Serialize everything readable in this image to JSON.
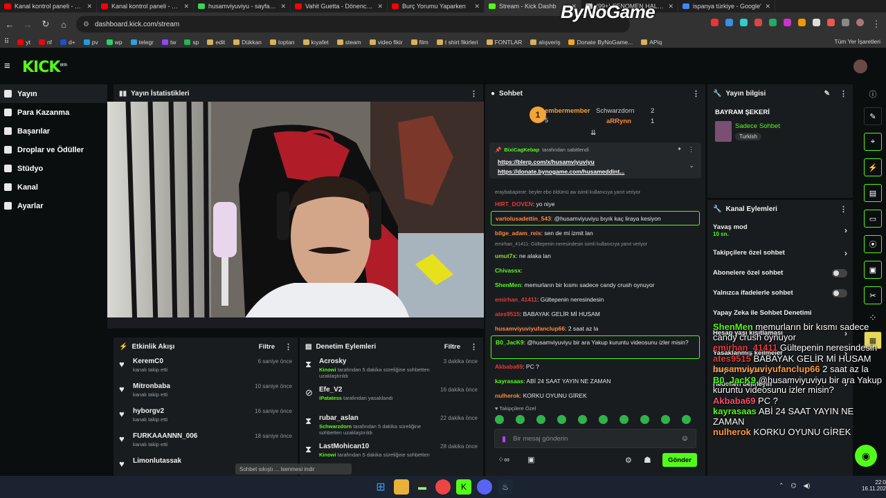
{
  "browser": {
    "tabs": [
      {
        "title": "Kanal kontrol paneli - You",
        "color": "#ff0000"
      },
      {
        "title": "Kanal kontrol paneli - You",
        "color": "#ff0000"
      },
      {
        "title": "husamviyuviyu - sayfa 2 -",
        "color": "#3ad35a"
      },
      {
        "title": "Vahit Guetta - Dönence M",
        "color": "#ff0000"
      },
      {
        "title": "Burç Yorumu Yaparken",
        "color": "#ff0000"
      },
      {
        "title": "Stream - Kick Dashb",
        "color": "#53fc18"
      },
      {
        "title": "(99+) FENOMEN HALO D",
        "color": "#cccccc"
      },
      {
        "title": "ispanya türkiye - Google'",
        "color": "#4285f4"
      }
    ],
    "url": "dashboard.kick.com/stream",
    "watermark": "ByNoGame",
    "bookmarks": [
      {
        "label": "yt",
        "color": "#ff0000"
      },
      {
        "label": "nf",
        "color": "#e50914"
      },
      {
        "label": "d+",
        "color": "#1f4fd1"
      },
      {
        "label": "pv",
        "color": "#1aa0e6"
      },
      {
        "label": "wp",
        "color": "#25d366"
      },
      {
        "label": "telegr",
        "color": "#2aa1da"
      },
      {
        "label": "tw",
        "color": "#9146ff"
      },
      {
        "label": "sp",
        "color": "#1db954"
      },
      {
        "label": "edit",
        "color": "#d8b15a"
      },
      {
        "label": "Dükkan",
        "color": "#d8b15a"
      },
      {
        "label": "toptan",
        "color": "#d8b15a"
      },
      {
        "label": "kıyafet",
        "color": "#d8b15a"
      },
      {
        "label": "steam",
        "color": "#d8b15a"
      },
      {
        "label": "video fikir",
        "color": "#d8b15a"
      },
      {
        "label": "film",
        "color": "#d8b15a"
      },
      {
        "label": "t shirt fikirleri",
        "color": "#d8b15a"
      },
      {
        "label": "FONTLAR",
        "color": "#d8b15a"
      },
      {
        "label": "alışveriş",
        "color": "#d8b15a"
      },
      {
        "label": "Donate ByNoGame...",
        "color": "#f5a623"
      },
      {
        "label": "APiq",
        "color": "#d8b15a"
      }
    ],
    "all_bookmarks": "Tüm Yer İşaretleri"
  },
  "kick": {
    "logo": "KICK",
    "logo_badge": "BETA",
    "sidebar": [
      {
        "label": "Yayın",
        "active": true
      },
      {
        "label": "Para Kazanma",
        "active": false
      },
      {
        "label": "Başarılar",
        "active": false
      },
      {
        "label": "Droplar ve Ödüller",
        "active": false
      },
      {
        "label": "Stüdyo",
        "active": false
      },
      {
        "label": "Kanal",
        "active": false
      },
      {
        "label": "Ayarlar",
        "active": false
      }
    ]
  },
  "stats_panel": {
    "title": "Yayın İstatistikleri"
  },
  "activity_panel": {
    "title": "Etkinlik Akışı",
    "filter": "Filtre",
    "items": [
      {
        "name": "KeremC0",
        "sub": "kanalı takip etti",
        "time": "6 saniye önce"
      },
      {
        "name": "Mitronbaba",
        "sub": "kanalı takip etti",
        "time": "10 saniye önce"
      },
      {
        "name": "hyborgv2",
        "sub": "kanalı takip etti",
        "time": "16 saniye önce"
      },
      {
        "name": "FURKAAANNN_006",
        "sub": "kanalı takip etti",
        "time": "18 saniye önce"
      },
      {
        "name": "Limonlutassak",
        "sub": "",
        "time": ""
      }
    ]
  },
  "moderation_panel": {
    "title": "Denetim Eylemleri",
    "filter": "Filtre",
    "items": [
      {
        "name": "Acrosky",
        "actor": "Kinowi",
        "sub": "tarafından 5 dakika süreliğine sohbetten uzaklaştırıldı",
        "time": "3 dakika önce",
        "icon": "⧗"
      },
      {
        "name": "Efe_V2",
        "actor": "iPatatess",
        "sub": "tarafından yasaklandı",
        "time": "16 dakika önce",
        "icon": "⊘"
      },
      {
        "name": "rubar_aslan",
        "actor": "Schwarzdorn",
        "sub": "tarafından 5 dakika süreliğine sohbetten uzaklaştırıldı",
        "time": "22 dakika önce",
        "icon": "⧗"
      },
      {
        "name": "LastMohican10",
        "actor": "Kinowi",
        "sub": "tarafından 5 dakika süreliğine sohbetten",
        "time": "28 dakika önce",
        "icon": "⧗"
      }
    ],
    "toast": "Sohbet sıkıştı ... lsenmesi indir"
  },
  "chat": {
    "title": "Sohbet",
    "leaderboard": {
      "first": {
        "name": "embermember",
        "count": "5"
      },
      "second": {
        "name": "Schwarzdorn",
        "count": "2"
      },
      "third": {
        "name": "aRRynn",
        "count": "1"
      }
    },
    "pinned": {
      "by": "BixiCagKebap",
      "by_suffix": "tarafından sabitlendi",
      "line1": "https://blerp.com/x/husamviyuviyu",
      "line2": "https://donate.bynogame.com/husameddint..."
    },
    "messages": [
      {
        "type": "reply",
        "text": "eraybabapirotr: beyler ebo öldümü aw isimli kullanıcıya yanıt veriyor"
      },
      {
        "type": "msg",
        "user": "HIRT_DOVEN",
        "color": "#e33b3b",
        "text": "yo niye"
      },
      {
        "type": "hl",
        "user": "vartolusadettin_543",
        "color": "#ff8a3c",
        "text": "@husamviyuviyu bıyık kaç liraya kesiyon"
      },
      {
        "type": "msg",
        "user": "bilge_adam_reis",
        "color": "#ff8a3c",
        "text": "sen de mi izmit lan"
      },
      {
        "type": "reply",
        "text": "emirhan_41411: Gültepenin neresindesin isimli kullanıcıya yanıt veriyor"
      },
      {
        "type": "msg",
        "user": "umut7x",
        "color": "#8bdc3c",
        "text": "ne alaka lan"
      },
      {
        "type": "msg",
        "user": "Chivassx",
        "color": "#53fc18",
        "text": ""
      },
      {
        "type": "msg",
        "user": "ShenMen",
        "color": "#53fc18",
        "text": "memurların bir kısmı sadece candy crush oynuyor"
      },
      {
        "type": "msg",
        "user": "emirhan_41411",
        "color": "#e33b3b",
        "text": "Gültepenin neresindesin"
      },
      {
        "type": "msg",
        "user": "ates9515",
        "color": "#e33b3b",
        "text": "BABAYAK GELİR Mİ HUSAM"
      },
      {
        "type": "msg",
        "user": "husamviyuviyufanclup66",
        "color": "#ff8a3c",
        "text": "2 saat az la"
      },
      {
        "type": "hl2",
        "user": "B0_JacK9",
        "color": "#53fc18",
        "text": "@husamviyuviyu bir ara Yakup kuruntu videosunu izler misin?"
      },
      {
        "type": "msg",
        "user": "Akbaba69",
        "color": "#e33b3b",
        "text": "PC ?"
      },
      {
        "type": "msg",
        "user": "kayrasaas",
        "color": "#53fc18",
        "text": "ABİ 24 SAAT YAYIN NE ZAMAN"
      },
      {
        "type": "msg",
        "user": "nulherok",
        "color": "#ff8a3c",
        "text": "KORKU OYUNU GİREK"
      }
    ],
    "followers_only": "Takipçilere Özel",
    "input_placeholder": "Bir mesaj gönderin",
    "send": "Gönder"
  },
  "stream_info": {
    "title": "Yayın bilgisi",
    "stream_title": "BAYRAM ŞEKERİ",
    "category": "Sadece Sohbet",
    "language": "Turkish"
  },
  "channel_actions": {
    "title": "Kanal Eylemleri",
    "slow_mode": "Yavaş mod",
    "slow_value": "10 sn.",
    "followers_chat": "Takipçilere özel sohbet",
    "subs_chat": "Abonelere özel sohbet",
    "emote_chat": "Yalnızca ifadelerle sohbet",
    "ai_mod": "Yapay Zeka ile Sohbet Denetimi",
    "age_limit": "Hesap yaşı kısıtlaması",
    "banned_words": "Yasaklanmış kelimeler",
    "viewer_mgmt": "İzleyici Yönetimi",
    "targets": "Hedefleri belirleyin"
  },
  "overlay_chat": [
    {
      "user": "ShenMen",
      "color": "#53fc18",
      "text": "memurların bir kısmı sadece candy crush oynuyor"
    },
    {
      "user": "emirhan_41411",
      "color": "#e33b3b",
      "text": "Gültepenin neresindesin"
    },
    {
      "user": "ates9515",
      "color": "#e33b3b",
      "text": "BABAYAK GELİR Mİ HUSAM"
    },
    {
      "user": "husamviyuviyufanclup66",
      "color": "#ff9b3c",
      "text": "2 saat az la"
    },
    {
      "user": "B0_JacK9",
      "color": "#53fc18",
      "text": "@husamviyuviyu bir ara Yakup kuruntu videosunu izler misin?"
    },
    {
      "user": "Akbaba69",
      "color": "#ff4d6d",
      "text": "PC ?"
    },
    {
      "user": "kayrasaas",
      "color": "#53fc18",
      "text": "ABİ 24 SAAT YAYIN NE ZAMAN"
    },
    {
      "user": "nulherok",
      "color": "#ff9b3c",
      "text": "KORKU OYUNU GİREK"
    }
  ],
  "taskbar": {
    "time": "22:04",
    "date": "16.11.2025"
  }
}
